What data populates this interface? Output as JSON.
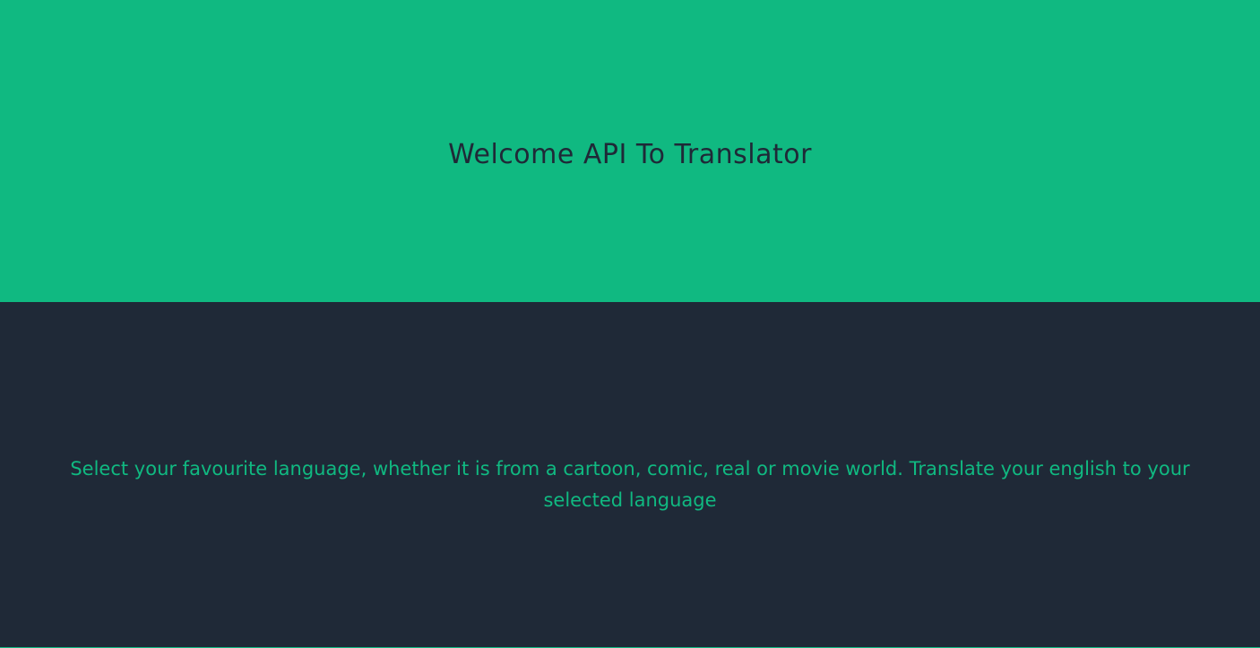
{
  "hero": {
    "title": "Welcome API To Translator"
  },
  "about": {
    "description": "Select your favourite language, whether it is from a cartoon, comic, real or movie world. Translate your english to your selected language"
  },
  "colors": {
    "accent": "#10b981",
    "dark": "#1f2937"
  }
}
